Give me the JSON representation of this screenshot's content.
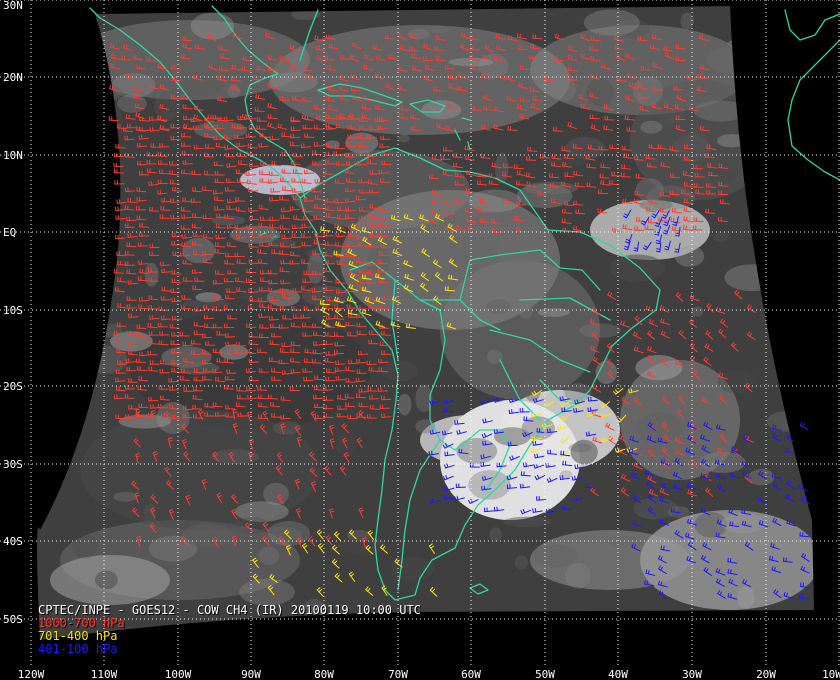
{
  "map": {
    "title": "CPTEC/INPE - GOES12 - COW CH4 (IR) 20100119 10:00 UTC",
    "legend": [
      {
        "label": "1000-700 hPa",
        "color": "#ff3b2f",
        "color_name": "red"
      },
      {
        "label": "701-400 hPa",
        "color": "#ffe600",
        "color_name": "yellow"
      },
      {
        "label": "401-100 hPa",
        "color": "#1a1aff",
        "color_name": "blue"
      }
    ],
    "latitude_labels": [
      "30N",
      "20N",
      "10N",
      "EQ",
      "10S",
      "20S",
      "30S",
      "40S",
      "50S"
    ],
    "longitude_labels": [
      "120W",
      "110W",
      "100W",
      "90W",
      "80W",
      "70W",
      "60W",
      "50W",
      "40W",
      "30W",
      "20W",
      "10W"
    ],
    "graticule": "dotted-white",
    "coastline_color": "#2fd6a3",
    "grid_color": "#ffffff",
    "layer_types": [
      "satellite-infrared-image",
      "country-boundaries",
      "wind-barbs"
    ],
    "icons": [
      "wind-barb-icon"
    ]
  }
}
